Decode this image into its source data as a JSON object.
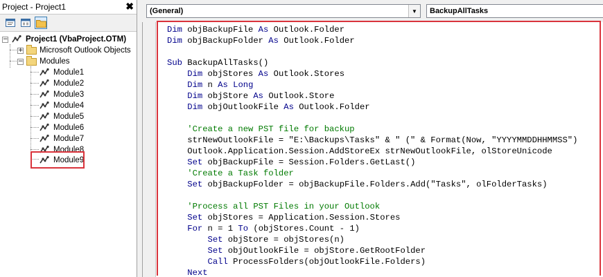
{
  "project_pane": {
    "title": "Project - Project1",
    "close": "✖",
    "toolbar": [
      "view-code",
      "view-object",
      "toggle-folders"
    ]
  },
  "tree": {
    "root": "Project1 (VbaProject.OTM)",
    "outlook_objects": "Microsoft Outlook Objects",
    "modules_folder": "Modules",
    "modules": [
      "Module1",
      "Module2",
      "Module3",
      "Module4",
      "Module5",
      "Module6",
      "Module7",
      "Module8",
      "Module9"
    ],
    "selected_module": "Module9"
  },
  "combos": {
    "object": "(General)",
    "procedure": "BackupAllTasks"
  },
  "code": [
    [
      {
        "t": "Dim",
        "c": "kw"
      },
      {
        "t": " objBackupFile "
      },
      {
        "t": "As",
        "c": "kw"
      },
      {
        "t": " Outlook.Folder"
      }
    ],
    [
      {
        "t": "Dim",
        "c": "kw"
      },
      {
        "t": " objBackupFolder "
      },
      {
        "t": "As",
        "c": "kw"
      },
      {
        "t": " Outlook.Folder"
      }
    ],
    [
      {
        "t": ""
      }
    ],
    [
      {
        "t": "Sub",
        "c": "kw"
      },
      {
        "t": " BackupAllTasks()"
      }
    ],
    [
      {
        "t": "    "
      },
      {
        "t": "Dim",
        "c": "kw"
      },
      {
        "t": " objStores "
      },
      {
        "t": "As",
        "c": "kw"
      },
      {
        "t": " Outlook.Stores"
      }
    ],
    [
      {
        "t": "    "
      },
      {
        "t": "Dim",
        "c": "kw"
      },
      {
        "t": " n "
      },
      {
        "t": "As",
        "c": "kw"
      },
      {
        "t": " "
      },
      {
        "t": "Long",
        "c": "kw"
      }
    ],
    [
      {
        "t": "    "
      },
      {
        "t": "Dim",
        "c": "kw"
      },
      {
        "t": " objStore "
      },
      {
        "t": "As",
        "c": "kw"
      },
      {
        "t": " Outlook.Store"
      }
    ],
    [
      {
        "t": "    "
      },
      {
        "t": "Dim",
        "c": "kw"
      },
      {
        "t": " objOutlookFile "
      },
      {
        "t": "As",
        "c": "kw"
      },
      {
        "t": " Outlook.Folder"
      }
    ],
    [
      {
        "t": ""
      }
    ],
    [
      {
        "t": "    "
      },
      {
        "t": "'Create a new PST file for backup",
        "c": "cm"
      }
    ],
    [
      {
        "t": "    strNewOutlookFile = \"E:\\Backups\\Tasks\" & \" (\" & Format(Now, \"YYYYMMDDHHMMSS\")"
      }
    ],
    [
      {
        "t": "    Outlook.Application.Session.AddStoreEx strNewOutlookFile, olStoreUnicode"
      }
    ],
    [
      {
        "t": "    "
      },
      {
        "t": "Set",
        "c": "kw"
      },
      {
        "t": " objBackupFile = Session.Folders.GetLast()"
      }
    ],
    [
      {
        "t": "    "
      },
      {
        "t": "'Create a Task folder",
        "c": "cm"
      }
    ],
    [
      {
        "t": "    "
      },
      {
        "t": "Set",
        "c": "kw"
      },
      {
        "t": " objBackupFolder = objBackupFile.Folders.Add(\"Tasks\", olFolderTasks)"
      }
    ],
    [
      {
        "t": ""
      }
    ],
    [
      {
        "t": "    "
      },
      {
        "t": "'Process all PST Files in your Outlook",
        "c": "cm"
      }
    ],
    [
      {
        "t": "    "
      },
      {
        "t": "Set",
        "c": "kw"
      },
      {
        "t": " objStores = Application.Session.Stores"
      }
    ],
    [
      {
        "t": "    "
      },
      {
        "t": "For",
        "c": "kw"
      },
      {
        "t": " n = 1 "
      },
      {
        "t": "To",
        "c": "kw"
      },
      {
        "t": " (objStores.Count - 1)"
      }
    ],
    [
      {
        "t": "        "
      },
      {
        "t": "Set",
        "c": "kw"
      },
      {
        "t": " objStore = objStores(n)"
      }
    ],
    [
      {
        "t": "        "
      },
      {
        "t": "Set",
        "c": "kw"
      },
      {
        "t": " objOutlookFile = objStore.GetRootFolder"
      }
    ],
    [
      {
        "t": "        "
      },
      {
        "t": "Call",
        "c": "kw"
      },
      {
        "t": " ProcessFolders(objOutlookFile.Folders)"
      }
    ],
    [
      {
        "t": "    "
      },
      {
        "t": "Next",
        "c": "kw"
      }
    ]
  ],
  "colors": {
    "keyword": "#00008b",
    "comment": "#007a00",
    "highlight": "#d9333b"
  }
}
